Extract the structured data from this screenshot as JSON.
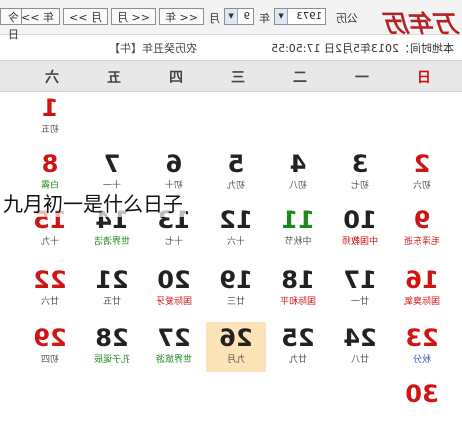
{
  "toolbar": {
    "brand": "万年历",
    "year_label": "公历",
    "year_value": "1973",
    "year_unit": "年",
    "month_value": "9",
    "month_unit": "月",
    "prev_year": "<< 年",
    "next_year": "年 >>",
    "prev_month": "<< 月",
    "next_month": "月 >>",
    "today": "今日"
  },
  "info": {
    "lunar": "农历癸丑年【牛】",
    "time": "本地时间：2013年5月2日 17:50:55"
  },
  "weekdays": [
    "日",
    "一",
    "二",
    "三",
    "四",
    "五",
    "六"
  ],
  "rows": [
    [
      {
        "day": "",
        "sub": ""
      },
      {
        "day": "",
        "sub": ""
      },
      {
        "day": "",
        "sub": ""
      },
      {
        "day": "",
        "sub": ""
      },
      {
        "day": "",
        "sub": ""
      },
      {
        "day": "",
        "sub": ""
      },
      {
        "day": "1",
        "sub": "初五"
      }
    ],
    [
      {
        "day": "2",
        "sub": "初六"
      },
      {
        "day": "3",
        "sub": "初七"
      },
      {
        "day": "4",
        "sub": "初八"
      },
      {
        "day": "5",
        "sub": "初九"
      },
      {
        "day": "6",
        "sub": "初十"
      },
      {
        "day": "7",
        "sub": "十一"
      },
      {
        "day": "8",
        "sub": "白露"
      }
    ],
    [
      {
        "day": "9",
        "sub": "毛泽东逝"
      },
      {
        "day": "10",
        "sub": "中国教师"
      },
      {
        "day": "11",
        "sub": "中秋节"
      },
      {
        "day": "12",
        "sub": "十六"
      },
      {
        "day": "13",
        "sub": "十七"
      },
      {
        "day": "14",
        "sub": "世界清洁"
      },
      {
        "day": "15",
        "sub": "十九"
      }
    ],
    [
      {
        "day": "16",
        "sub": "国际臭氧"
      },
      {
        "day": "17",
        "sub": "廿一"
      },
      {
        "day": "18",
        "sub": "国际和平"
      },
      {
        "day": "19",
        "sub": "廿三"
      },
      {
        "day": "20",
        "sub": "国际爱牙"
      },
      {
        "day": "21",
        "sub": "廿五"
      },
      {
        "day": "22",
        "sub": "廿六"
      }
    ],
    [
      {
        "day": "23",
        "sub": "秋分"
      },
      {
        "day": "24",
        "sub": "廿八"
      },
      {
        "day": "25",
        "sub": "廿九"
      },
      {
        "day": "26",
        "sub": "九月"
      },
      {
        "day": "27",
        "sub": "世界旅游"
      },
      {
        "day": "28",
        "sub": "孔子诞辰"
      },
      {
        "day": "29",
        "sub": "初四"
      }
    ],
    [
      {
        "day": "30",
        "sub": ""
      },
      {
        "day": "",
        "sub": ""
      },
      {
        "day": "",
        "sub": ""
      },
      {
        "day": "",
        "sub": ""
      },
      {
        "day": "",
        "sub": ""
      },
      {
        "day": "",
        "sub": ""
      },
      {
        "day": "",
        "sub": ""
      }
    ]
  ],
  "caption": "九月初一是什么日子",
  "colors": {
    "weekend_red": "#d01414",
    "festival_green": "#1b8a1b",
    "today_bg": "#fde3b8"
  }
}
